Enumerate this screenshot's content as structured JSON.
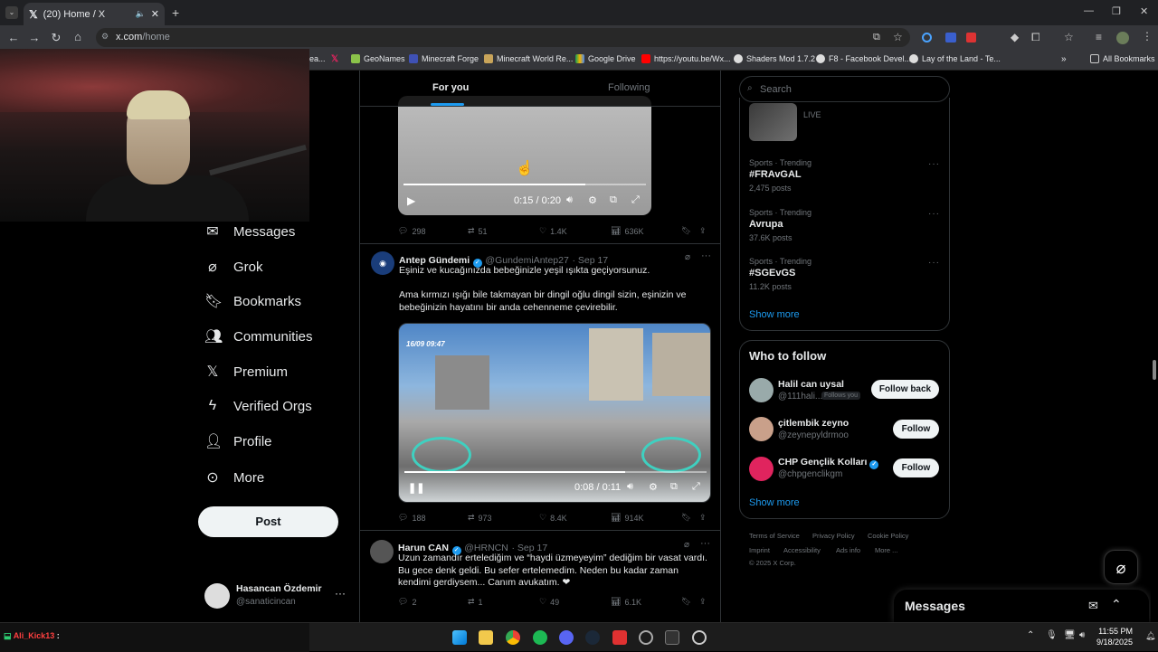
{
  "browser": {
    "tab_title": "(20) Home / X",
    "url_host": "x.com",
    "url_path": "/home",
    "bookmarks": [
      "ea...",
      "GeoNames",
      "Minecraft Forge",
      "Minecraft World Re...",
      "Google Drive",
      "https://youtu.be/Wx...",
      "Shaders Mod 1.7.2",
      "F8 - Facebook Devel...",
      "Lay of the Land - Te..."
    ],
    "all_bookmarks": "All Bookmarks"
  },
  "nav": {
    "items": [
      "Messages",
      "Grok",
      "Bookmarks",
      "Communities",
      "Premium",
      "Verified Orgs",
      "Profile",
      "More"
    ],
    "post_label": "Post"
  },
  "account": {
    "name": "Hasancan Özdemir",
    "handle": "@sanaticincan"
  },
  "timeline": {
    "tabs": [
      "For you",
      "Following"
    ],
    "video1": {
      "time": "0:15 / 0:20",
      "stats": [
        "298",
        "51",
        "1.4K",
        "636K"
      ]
    },
    "tweet2": {
      "name": "Antep Gündemi",
      "handle": "@GundemiAntep27",
      "date": "· Sep 17",
      "text1": "Eşiniz ve kucağınızda bebeğinizle yeşil ışıkta geçiyorsunuz.",
      "text2": "Ama kırmızı ışığı bile takmayan bir dingil oğlu dingil sizin, eşinizin ve bebeğinizin hayatını bir anda cehenneme çevirebilir.",
      "video_time": "0:08 / 0:11",
      "overlay_date": "16/09 09:47",
      "stats": [
        "188",
        "973",
        "8.4K",
        "914K"
      ]
    },
    "tweet3": {
      "name": "Harun CAN",
      "handle": "@HRNCN",
      "date": "· Sep 17",
      "text": "Uzun zamandır ertelediğim ve “haydi üzmeyeyim” dediğim bir vasat vardı. Bu gece denk geldi. Bu sefer ertelemedim. Neden bu kadar zaman kendimi gerdiysem... Canım avukatım. ❤",
      "stats": [
        "2",
        "1",
        "49",
        "6.1K"
      ]
    }
  },
  "sidebar": {
    "search_placeholder": "Search",
    "live_label": "LIVE",
    "trends": [
      {
        "category": "Sports · Trending",
        "name": "#FRAvGAL",
        "posts": "2,475 posts"
      },
      {
        "category": "Sports · Trending",
        "name": "Avrupa",
        "posts": "37.6K posts"
      },
      {
        "category": "Sports · Trending",
        "name": "#SGEvGS",
        "posts": "11.2K posts"
      }
    ],
    "show_more": "Show more",
    "who_to_follow": "Who to follow",
    "follow_suggestions": [
      {
        "name": "Halil can uysal",
        "handle": "@111hali...",
        "badge": "Follows you",
        "button": "Follow back"
      },
      {
        "name": "çitlembik zeyno",
        "handle": "@zeynepyldrmoo",
        "button": "Follow"
      },
      {
        "name": "CHP Gençlik Kolları",
        "handle": "@chpgenclikgm",
        "button": "Follow"
      }
    ],
    "footer": [
      "Terms of Service",
      "Privacy Policy",
      "Cookie Policy",
      "Imprint",
      "Accessibility",
      "Ads info",
      "More ...",
      "© 2025 X Corp."
    ]
  },
  "messages_dock": {
    "title": "Messages"
  },
  "chat_overlay": {
    "user": "Ali_Kick13",
    "sep": ":"
  },
  "taskbar": {
    "time": "11:55 PM",
    "date": "9/18/2025"
  },
  "colors": {
    "accent": "#1d9bf0",
    "background": "#000000",
    "border": "#2f3336"
  }
}
